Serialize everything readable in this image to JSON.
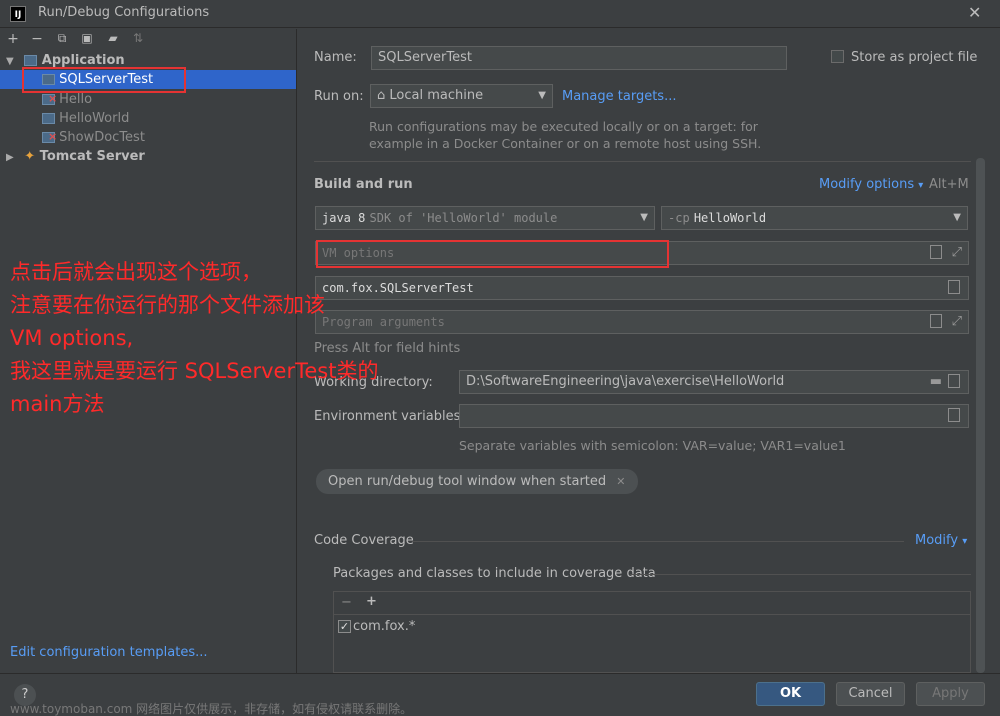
{
  "window": {
    "title": "Run/Debug Configurations",
    "app_icon_text": "IJ"
  },
  "sidebar": {
    "toolbar_icons": [
      "add-icon",
      "remove-icon",
      "copy-icon",
      "save-icon",
      "folder-add-icon",
      "sort-icon"
    ],
    "tree": [
      {
        "label": "Application"
      },
      {
        "label": "SQLServerTest"
      },
      {
        "label": "Hello"
      },
      {
        "label": "HelloWorld"
      },
      {
        "label": "ShowDocTest"
      },
      {
        "label": "Tomcat Server"
      }
    ],
    "edit_templates_link": "Edit configuration templates..."
  },
  "form": {
    "name_label": "Name:",
    "name_value": "SQLServerTest",
    "store_as_project_file": "Store as project file",
    "run_on_label": "Run on:",
    "run_on_value": "Local machine",
    "manage_targets": "Manage targets...",
    "run_on_hint_1": "Run configurations may be executed locally or on a target: for",
    "run_on_hint_2": "example in a Docker Container or on a remote host using SSH.",
    "build_and_run": "Build and run",
    "modify_options": "Modify options",
    "modify_shortcut": "Alt+M",
    "sdk_java": "java 8",
    "sdk_desc": "SDK of 'HelloWorld' module",
    "cp_flag": "-cp",
    "cp_value": "HelloWorld",
    "vm_options_placeholder": "VM options",
    "main_class": "com.fox.SQLServerTest",
    "program_args_placeholder": "Program arguments",
    "field_hints": "Press Alt for field hints",
    "working_dir_label": "Working directory:",
    "working_dir_value": "D:\\SoftwareEngineering\\java\\exercise\\HelloWorld",
    "env_vars_label": "Environment variables:",
    "env_hint": "Separate variables with semicolon: VAR=value; VAR1=value1",
    "chip_label": "Open run/debug tool window when started",
    "code_coverage": "Code Coverage",
    "modify": "Modify",
    "packages_label": "Packages and classes to include in coverage data",
    "coverage_item": "com.fox.*"
  },
  "buttons": {
    "ok": "OK",
    "cancel": "Cancel",
    "apply": "Apply",
    "help": "?"
  },
  "annotation": {
    "line1": "点击后就会出现这个选项，",
    "line2": "注意要在你运行的那个文件添加该",
    "line3": "VM options,",
    "line4": "我这里就是要运行 SQLServerTest类的",
    "line5": "main方法"
  },
  "watermark": "www.toymoban.com 网络图片仅供展示，非存储，如有侵权请联系删除。",
  "colors": {
    "accent": "#589df6",
    "selection": "#2f65ca",
    "annotation": "#ff2a2a",
    "highlight_box": "#e53333"
  }
}
